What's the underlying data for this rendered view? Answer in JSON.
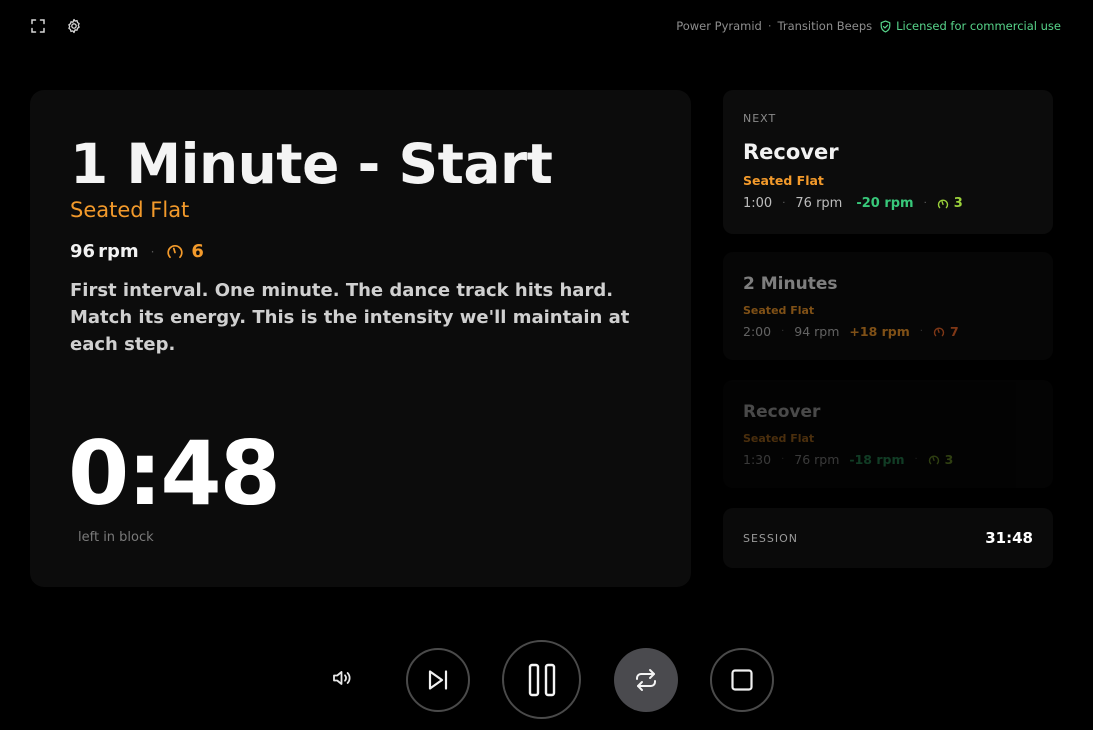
{
  "topbar": {
    "workout_name": "Power Pyramid",
    "audio_mode": "Transition Beeps",
    "separator": "·",
    "license": "Licensed for commercial use"
  },
  "current": {
    "title": "1 Minute - Start",
    "position": "Seated Flat",
    "rpm_value": "96",
    "rpm_unit": "rpm",
    "separator": "·",
    "resistance": "6",
    "description": "First interval. One minute. The dance track hits hard. Match its energy. This is the intensity we'll maintain at each step.",
    "timer": "0:48",
    "timer_label": "left in block"
  },
  "queue": [
    {
      "eyebrow": "NEXT",
      "title": "Recover",
      "position": "Seated Flat",
      "duration": "1:00",
      "rpm": "76 rpm",
      "delta": "-20 rpm",
      "resistance": "3"
    },
    {
      "title": "2 Minutes",
      "position": "Seated Flat",
      "duration": "2:00",
      "rpm": "94 rpm",
      "delta": "+18 rpm",
      "resistance": "7"
    },
    {
      "title": "Recover",
      "position": "Seated Flat",
      "duration": "1:30",
      "rpm": "76 rpm",
      "delta": "-18 rpm",
      "resistance": "3"
    }
  ],
  "session": {
    "label": "SESSION",
    "time": "31:48"
  },
  "colors": {
    "accent_orange": "#f39a2b",
    "accent_green": "#38c87a",
    "license_green": "#57d48a",
    "resistance_green": "#9bd13b",
    "background": "#000000",
    "card": "#0c0c0c"
  },
  "icons": {
    "fullscreen": "fullscreen-icon",
    "settings": "gear-icon",
    "license": "shield-check-icon",
    "resistance": "gauge-icon",
    "volume": "volume-icon",
    "skip": "skip-next-icon",
    "pause": "pause-icon",
    "loop": "repeat-icon",
    "stop": "stop-icon"
  }
}
